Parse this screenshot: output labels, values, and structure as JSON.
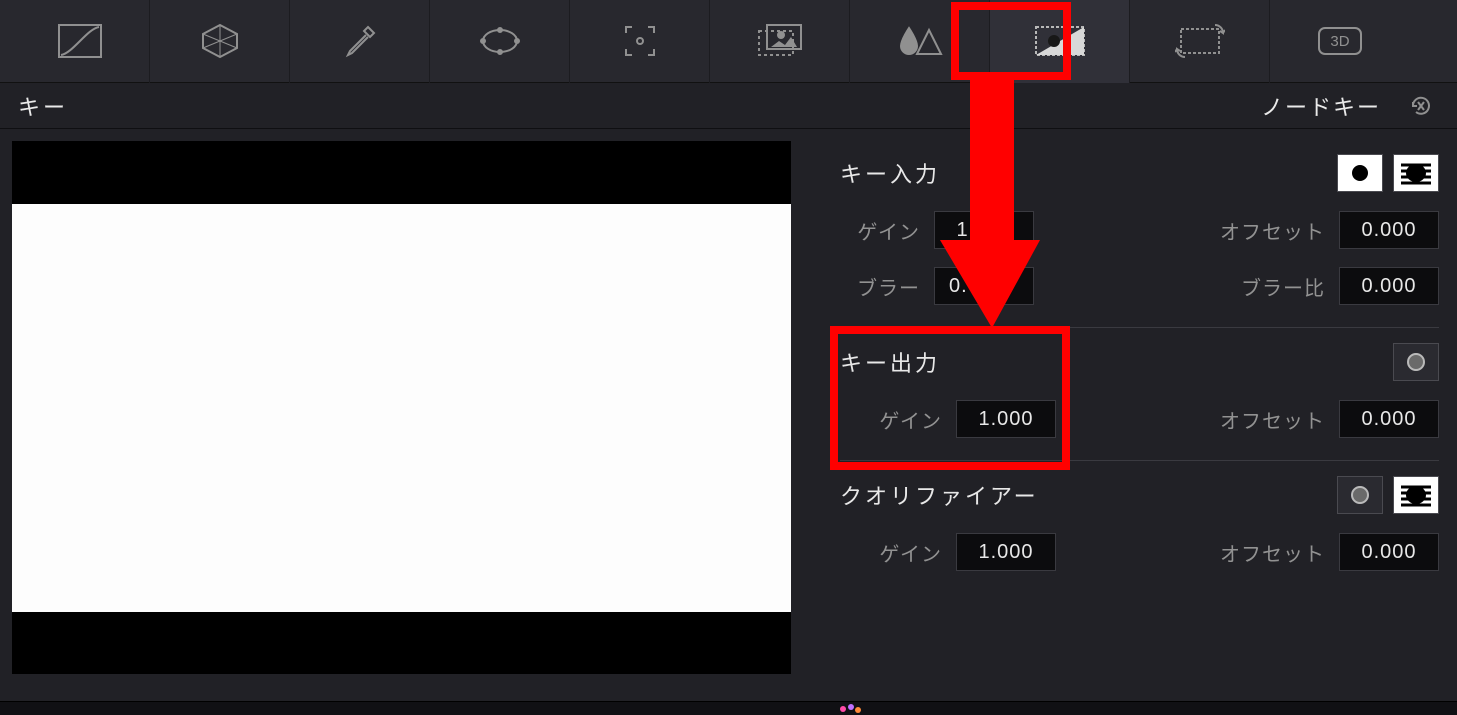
{
  "toolbar": {
    "tools": [
      "curves",
      "vectorscope",
      "eyedropper",
      "mask-shape",
      "tracker",
      "fx",
      "drop-sat",
      "key",
      "sizing",
      "3d"
    ],
    "active_tool_index": 7
  },
  "header": {
    "title": "キー",
    "right_label": "ノードキー",
    "reset_icon": "reset-icon"
  },
  "sections": {
    "key_input": {
      "title": "キー入力",
      "icons": [
        "matte-invert-icon",
        "matte-lines-icon"
      ],
      "gain_label": "ゲイン",
      "gain_value": "1.000",
      "offset_label": "オフセット",
      "offset_value": "0.000",
      "blur_label": "ブラー",
      "blur_value": "0.",
      "blur_ratio_label": "ブラー比",
      "blur_ratio_value": "0.000"
    },
    "key_output": {
      "title": "キー出力",
      "icons": [
        "circle-output-icon"
      ],
      "gain_label": "ゲイン",
      "gain_value": "1.000",
      "offset_label": "オフセット",
      "offset_value": "0.000"
    },
    "qualifier": {
      "title": "クオリファイアー",
      "icons": [
        "circle-output-icon",
        "matte-lines-icon"
      ],
      "gain_label": "ゲイン",
      "gain_value": "1.000",
      "offset_label": "オフセット",
      "offset_value": "0.000"
    }
  },
  "annotations": {
    "arrow_color": "#ff0000",
    "highlight_color": "#ff0000"
  }
}
